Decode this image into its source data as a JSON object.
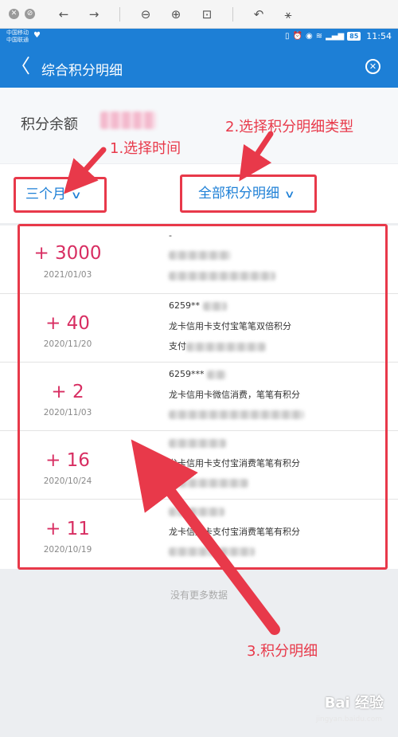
{
  "viewer": {
    "icons": [
      "close-circle-icon",
      "stop-circle-icon",
      "back-arrow-icon",
      "forward-arrow-icon",
      "zoom-out-icon",
      "zoom-in-icon",
      "fit-icon",
      "rotate-icon",
      "magic-wand-icon"
    ]
  },
  "statusbar": {
    "carrier1": "中国移动",
    "carrier2": "中国联通",
    "battery": "85",
    "time": "11:54"
  },
  "navbar": {
    "title": "综合积分明细"
  },
  "balance": {
    "label": "积分余额"
  },
  "filters": {
    "time_label": "三个月",
    "type_label": "全部积分明细"
  },
  "records": [
    {
      "amount": "+ 3000",
      "date": "2021/01/03",
      "lines": [
        "-",
        "",
        ""
      ]
    },
    {
      "amount": "+ 40",
      "date": "2020/11/20",
      "lines": [
        "6259**",
        "龙卡信用卡支付宝笔笔双倍积分",
        "支付"
      ]
    },
    {
      "amount": "+ 2",
      "date": "2020/11/03",
      "lines": [
        "6259***",
        "龙卡信用卡微信消费，笔笔有积分",
        ""
      ]
    },
    {
      "amount": "+ 16",
      "date": "2020/10/24",
      "lines": [
        "",
        "龙卡信用卡支付宝消费笔笔有积分",
        ""
      ]
    },
    {
      "amount": "+ 11",
      "date": "2020/10/19",
      "lines": [
        "",
        "龙卡信用卡支付宝消费笔笔有积分",
        ""
      ]
    }
  ],
  "footer": {
    "no_more": "没有更多数据"
  },
  "annotations": {
    "step1": "1.选择时间",
    "step2": "2.选择积分明细类型",
    "step3": "3.积分明细"
  },
  "watermark": {
    "text": "Bai 经验",
    "sub": "jingyan.baidu.com"
  },
  "colors": {
    "brand_blue": "#1d7fd6",
    "amount_pink": "#d82e62",
    "annotation_red": "#e8394a"
  }
}
